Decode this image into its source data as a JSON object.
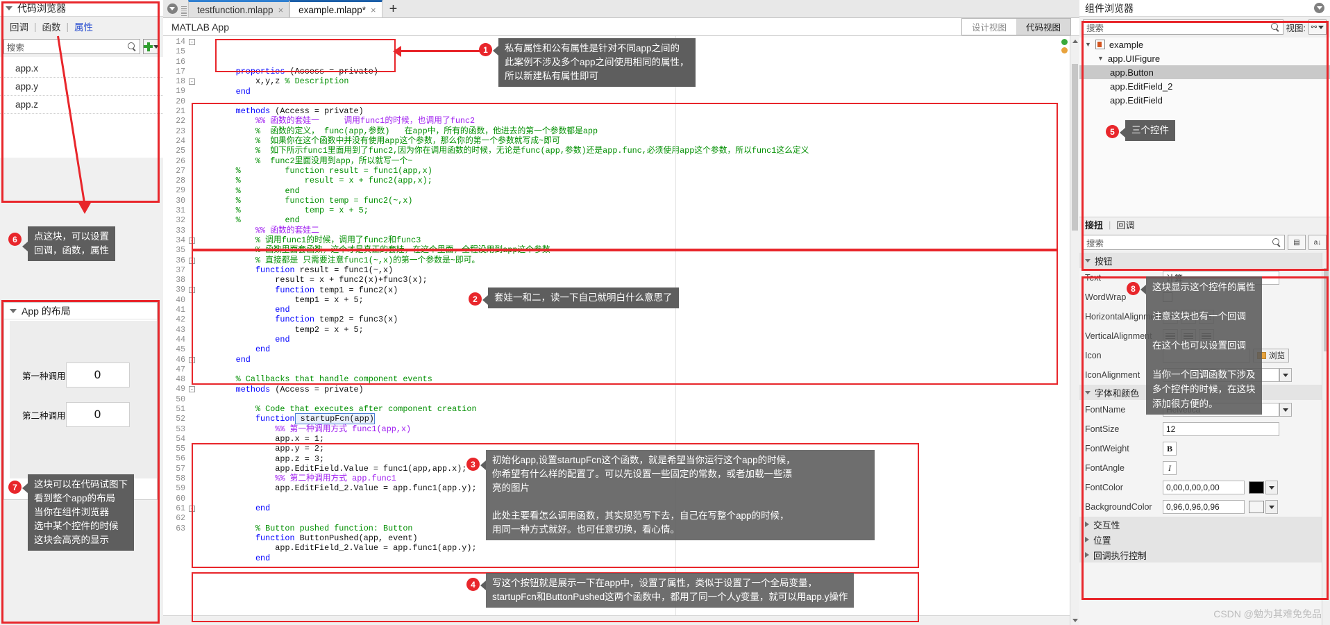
{
  "left_panel": {
    "title": "代码浏览器",
    "tabs": [
      {
        "label": "回调",
        "active": false
      },
      {
        "label": "函数",
        "active": false
      },
      {
        "label": "属性",
        "active": true
      }
    ],
    "separator": "|",
    "search_placeholder": "搜索",
    "add_button_icon": "plus-icon",
    "items": [
      "app.x",
      "app.y",
      "app.z"
    ],
    "layout_panel": {
      "title": "App 的布局",
      "fields": [
        {
          "label": "第一种调用",
          "value": "0"
        },
        {
          "label": "第二种调用",
          "value": "0"
        }
      ]
    }
  },
  "center": {
    "tabs": [
      {
        "label": "testfunction.mlapp",
        "active": false,
        "close": "×"
      },
      {
        "label": "example.mlapp*",
        "active": true,
        "close": "×"
      }
    ],
    "new_tab": "+",
    "app_title": "MATLAB App",
    "view_toggle": [
      {
        "label": "设计视图",
        "active": false
      },
      {
        "label": "代码视图",
        "active": true
      }
    ],
    "first_line_number": 14,
    "code_lines": [
      {
        "n": 14,
        "fold": "-",
        "indent": 2,
        "segs": [
          {
            "t": "properties",
            "c": "kw"
          },
          {
            "t": " (Access = private)",
            "c": ""
          }
        ]
      },
      {
        "n": 15,
        "indent": 3,
        "segs": [
          {
            "t": "x,y,z ",
            "c": ""
          },
          {
            "t": "% Description",
            "c": "cm"
          }
        ]
      },
      {
        "n": 16,
        "indent": 2,
        "segs": [
          {
            "t": "end",
            "c": "kw"
          }
        ]
      },
      {
        "n": 17,
        "indent": 0,
        "segs": []
      },
      {
        "n": 18,
        "fold": "-",
        "indent": 2,
        "segs": [
          {
            "t": "methods",
            "c": "kw"
          },
          {
            "t": " (Access = private)",
            "c": ""
          }
        ]
      },
      {
        "n": 19,
        "indent": 3,
        "segs": [
          {
            "t": "%% 函数的套娃一     调用func1的时候，也调用了func2",
            "c": "cmh"
          }
        ]
      },
      {
        "n": 20,
        "indent": 3,
        "segs": [
          {
            "t": "%  函数的定义， func(app,参数)   在app中，所有的函数，他进去的第一个参数都是app",
            "c": "cm"
          }
        ]
      },
      {
        "n": 21,
        "indent": 3,
        "segs": [
          {
            "t": "%  如果你在这个函数中并没有使用app这个参数，那么你的第一个参数就写成~即可",
            "c": "cm"
          }
        ]
      },
      {
        "n": 22,
        "indent": 3,
        "segs": [
          {
            "t": "%  如下所示func1里面用到了func2,因为你在调用函数的时候，无论是func(app,参数)还是app.func,必须使用app这个参数，所以func1这么定义",
            "c": "cm"
          }
        ]
      },
      {
        "n": 23,
        "indent": 3,
        "segs": [
          {
            "t": "%  func2里面没用到app，所以就写一个~",
            "c": "cm"
          }
        ]
      },
      {
        "n": 24,
        "indent": 2,
        "segs": [
          {
            "t": "%",
            "c": "cm"
          },
          {
            "t": "         function result = func1(app,x)",
            "c": "cm"
          }
        ]
      },
      {
        "n": 25,
        "indent": 2,
        "segs": [
          {
            "t": "%",
            "c": "cm"
          },
          {
            "t": "             result = x + func2(app,x);",
            "c": "cm"
          }
        ]
      },
      {
        "n": 26,
        "indent": 2,
        "segs": [
          {
            "t": "%",
            "c": "cm"
          },
          {
            "t": "         end",
            "c": "cm"
          }
        ]
      },
      {
        "n": 27,
        "indent": 2,
        "segs": [
          {
            "t": "%",
            "c": "cm"
          },
          {
            "t": "         function temp = func2(~,x)",
            "c": "cm"
          }
        ]
      },
      {
        "n": 28,
        "indent": 2,
        "segs": [
          {
            "t": "%",
            "c": "cm"
          },
          {
            "t": "             temp = x + 5;",
            "c": "cm"
          }
        ]
      },
      {
        "n": 29,
        "indent": 2,
        "segs": [
          {
            "t": "%",
            "c": "cm"
          },
          {
            "t": "         end",
            "c": "cm"
          }
        ]
      },
      {
        "n": 30,
        "indent": 3,
        "segs": [
          {
            "t": "%% 函数的套娃二",
            "c": "cmh"
          }
        ]
      },
      {
        "n": 31,
        "indent": 3,
        "segs": [
          {
            "t": "% 调用func1的时候，调用了func2和func3",
            "c": "cm"
          }
        ]
      },
      {
        "n": 32,
        "indent": 3,
        "segs": [
          {
            "t": "% 函数里面套函数，这个才是真正的套娃，在这个里面，全程没用到app这个参数",
            "c": "cm"
          }
        ]
      },
      {
        "n": 33,
        "indent": 3,
        "segs": [
          {
            "t": "% 直接都是 只需要注意func1(~,x)的第一个参数是~即可。",
            "c": "cm"
          }
        ]
      },
      {
        "n": 34,
        "fold": "-",
        "indent": 3,
        "segs": [
          {
            "t": "function",
            "c": "kw"
          },
          {
            "t": " result = func1(~,x)",
            "c": ""
          }
        ]
      },
      {
        "n": 35,
        "indent": 4,
        "segs": [
          {
            "t": "result = x + func2(x)+func3(x);",
            "c": ""
          }
        ]
      },
      {
        "n": 36,
        "fold": "-",
        "indent": 4,
        "segs": [
          {
            "t": "function",
            "c": "kw"
          },
          {
            "t": " temp1 = func2(x)",
            "c": ""
          }
        ]
      },
      {
        "n": 37,
        "indent": 5,
        "segs": [
          {
            "t": "temp1 = x + 5;",
            "c": ""
          }
        ]
      },
      {
        "n": 38,
        "indent": 4,
        "segs": [
          {
            "t": "end",
            "c": "kw"
          }
        ]
      },
      {
        "n": 39,
        "fold": "-",
        "indent": 4,
        "segs": [
          {
            "t": "function",
            "c": "kw"
          },
          {
            "t": " temp2 = func3(x)",
            "c": ""
          }
        ]
      },
      {
        "n": 40,
        "indent": 5,
        "segs": [
          {
            "t": "temp2 = x + 5;",
            "c": ""
          }
        ]
      },
      {
        "n": 41,
        "indent": 4,
        "segs": [
          {
            "t": "end",
            "c": "kw"
          }
        ]
      },
      {
        "n": 42,
        "indent": 3,
        "segs": [
          {
            "t": "end",
            "c": "kw"
          }
        ]
      },
      {
        "n": 43,
        "indent": 2,
        "segs": [
          {
            "t": "end",
            "c": "kw"
          }
        ]
      },
      {
        "n": 44,
        "indent": 0,
        "segs": []
      },
      {
        "n": 45,
        "indent": 2,
        "segs": [
          {
            "t": "% Callbacks that handle component events",
            "c": "cm"
          }
        ]
      },
      {
        "n": 46,
        "fold": "-",
        "indent": 2,
        "segs": [
          {
            "t": "methods",
            "c": "kw"
          },
          {
            "t": " (Access = private)",
            "c": ""
          }
        ]
      },
      {
        "n": 47,
        "indent": 0,
        "segs": []
      },
      {
        "n": 48,
        "indent": 3,
        "segs": [
          {
            "t": "% Code that executes after component creation",
            "c": "cm"
          }
        ]
      },
      {
        "n": 49,
        "fold": "-",
        "indent": 3,
        "segs": [
          {
            "t": "function",
            "c": "kw"
          },
          {
            "t": " startupFcn(app)",
            "c": "box"
          }
        ]
      },
      {
        "n": 50,
        "indent": 4,
        "segs": [
          {
            "t": "%% 第一种调用方式 func1(app,x)",
            "c": "cmh"
          }
        ]
      },
      {
        "n": 51,
        "indent": 4,
        "segs": [
          {
            "t": "app.x = 1;",
            "c": ""
          }
        ]
      },
      {
        "n": 52,
        "indent": 4,
        "segs": [
          {
            "t": "app.y = 2;",
            "c": ""
          }
        ]
      },
      {
        "n": 53,
        "indent": 4,
        "segs": [
          {
            "t": "app.z = 3;",
            "c": ""
          }
        ]
      },
      {
        "n": 54,
        "indent": 4,
        "segs": [
          {
            "t": "app.EditField.Value = func1(app,app.x);",
            "c": ""
          }
        ]
      },
      {
        "n": 55,
        "indent": 4,
        "segs": [
          {
            "t": "%% 第二种调用方式 app.func1",
            "c": "cmh"
          }
        ]
      },
      {
        "n": 56,
        "indent": 4,
        "segs": [
          {
            "t": "app.EditField_2.Value = app.func1(app.y);",
            "c": ""
          }
        ]
      },
      {
        "n": 57,
        "indent": 0,
        "segs": []
      },
      {
        "n": 58,
        "indent": 3,
        "segs": [
          {
            "t": "end",
            "c": "kw"
          }
        ]
      },
      {
        "n": 59,
        "indent": 0,
        "segs": []
      },
      {
        "n": 60,
        "indent": 3,
        "segs": [
          {
            "t": "% Button pushed function: Button",
            "c": "cm"
          }
        ]
      },
      {
        "n": 61,
        "fold": "-",
        "indent": 3,
        "segs": [
          {
            "t": "function",
            "c": "kw"
          },
          {
            "t": " ButtonPushed(app, event)",
            "c": ""
          }
        ]
      },
      {
        "n": 62,
        "indent": 4,
        "segs": [
          {
            "t": "app.EditField_2.Value = app.func1(app.y);",
            "c": ""
          }
        ]
      },
      {
        "n": 63,
        "indent": 3,
        "segs": [
          {
            "t": "end",
            "c": "kw"
          }
        ]
      }
    ]
  },
  "right_panel": {
    "title": "组件浏览器",
    "search_placeholder": "搜索",
    "view_label": "视图:",
    "tree": [
      {
        "label": "example",
        "depth": 0,
        "expander": "▼",
        "icon": "app-file-icon",
        "selected": false
      },
      {
        "label": "app.UIFigure",
        "depth": 1,
        "expander": "▼",
        "selected": false
      },
      {
        "label": "app.Button",
        "depth": 2,
        "expander": "",
        "selected": true
      },
      {
        "label": "app.EditField_2",
        "depth": 2,
        "expander": "",
        "selected": false
      },
      {
        "label": "app.EditField",
        "depth": 2,
        "expander": "",
        "selected": false
      }
    ],
    "lower_tabs": [
      {
        "label": "接扭",
        "active": true
      },
      {
        "label": "回调",
        "active": false
      }
    ],
    "inspector_search_placeholder": "搜索",
    "groups": [
      {
        "name": "按钮",
        "rows": [
          {
            "label": "Text",
            "type": "text",
            "value": "计算"
          },
          {
            "label": "WordWrap",
            "type": "checkbox",
            "value": ""
          },
          {
            "label": "HorizontalAlignment",
            "type": "align3",
            "value": ""
          },
          {
            "label": "VerticalAlignment",
            "type": "align3",
            "value": ""
          },
          {
            "label": "Icon",
            "type": "text-browse",
            "value": "",
            "browse_label": "浏览"
          },
          {
            "label": "IconAlignment",
            "type": "dropdown",
            "value": ""
          }
        ]
      },
      {
        "name": "字体和颜色",
        "rows": [
          {
            "label": "FontName",
            "type": "dropdown",
            "value": "Helvetica"
          },
          {
            "label": "FontSize",
            "type": "text",
            "value": "12"
          },
          {
            "label": "FontWeight",
            "type": "bold-toggle",
            "value": "B"
          },
          {
            "label": "FontAngle",
            "type": "italic-toggle",
            "value": "I"
          },
          {
            "label": "FontColor",
            "type": "color",
            "value": "0,00,0,00,0,00",
            "swatch": "#000000"
          },
          {
            "label": "BackgroundColor",
            "type": "color",
            "value": "0,96,0,96,0,96",
            "swatch": "#f5f5f5"
          }
        ]
      },
      {
        "name": "交互性",
        "collapsed": true,
        "rows": []
      },
      {
        "name": "位置",
        "collapsed": true,
        "rows": []
      },
      {
        "name": "回调执行控制",
        "collapsed": true,
        "rows": []
      }
    ]
  },
  "annotations": [
    {
      "id": "1",
      "number": "1",
      "text": "私有属性和公有属性是针对不同app之间的\n此案例不涉及多个app之间使用相同的属性，\n所以新建私有属性即可"
    },
    {
      "id": "2",
      "number": "2",
      "text": "套娃一和二，读一下自己就明白什么意思了"
    },
    {
      "id": "3",
      "number": "3",
      "text": "初始化app,设置startupFcn这个函数，就是希望当你运行这个app的时候，\n你希望有什么样的配置了。可以先设置一些固定的常数，或者加载一些漂\n亮的图片\n\n此处主要看怎么调用函数，其实规范写下去，自己在写整个app的时候，\n用同一种方式就好。也可任意切换，看心情。"
    },
    {
      "id": "4",
      "number": "4",
      "text": "写这个按钮就是展示一下在app中，设置了属性，类似于设置了一个全局变量，\nstartupFcn和ButtonPushed这两个函数中，都用了同一个人y变量，就可以用app.y操作"
    },
    {
      "id": "5",
      "number": "5",
      "text": "三个控件"
    },
    {
      "id": "6",
      "number": "6",
      "text": "点这块，可以设置\n回调，函数，属性"
    },
    {
      "id": "7",
      "number": "7",
      "text": "这块可以在代码试图下\n看到整个app的布局\n当你在组件浏览器\n选中某个控件的时候\n这块会高亮的显示"
    },
    {
      "id": "8",
      "number": "8",
      "text": "这块显示这个控件的属性\n\n注意这块也有一个回调\n\n在这个也可以设置回调\n\n当你一个回调函数下涉及\n多个控件的时候，在这块\n添加很方便的。"
    }
  ],
  "watermark": "CSDN @勉为其难免免品",
  "colors": {
    "annotation_red": "#e8262b",
    "callout_gray": "#5e5e5e",
    "selection_gray": "#c9c9c9",
    "tab_blue": "#2f7fd0",
    "keyword_blue": "#0000ff",
    "comment_green": "#028f02",
    "section_purple": "#a020f0"
  }
}
